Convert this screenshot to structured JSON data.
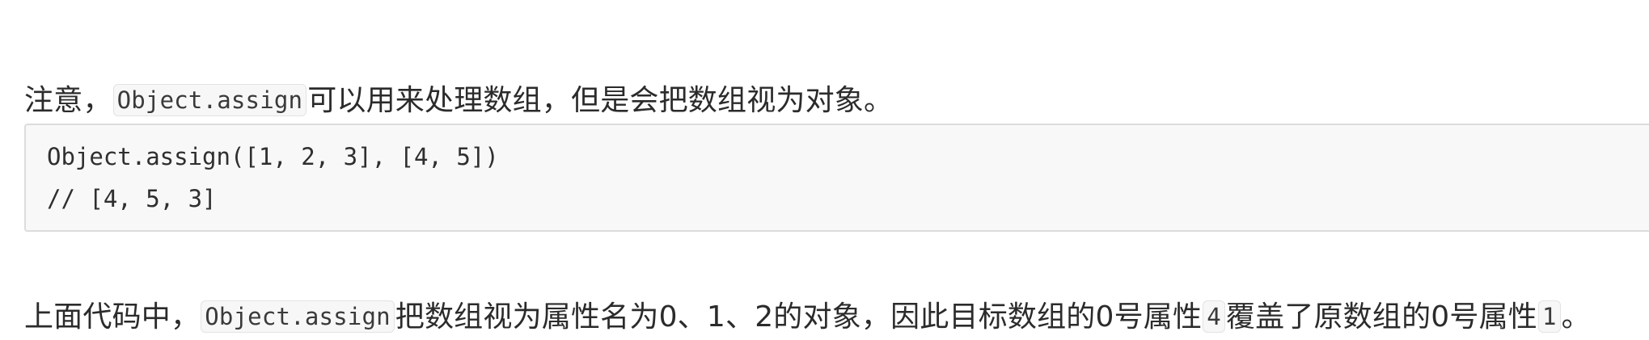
{
  "paragraph1": {
    "text_before": "注意，",
    "code": "Object.assign",
    "text_after": "可以用来处理数组，但是会把数组视为对象。"
  },
  "code_block": {
    "lines": [
      "Object.assign([1, 2, 3], [4, 5])",
      "// [4, 5, 3]"
    ]
  },
  "paragraph2": {
    "text_before": "上面代码中，",
    "code1": "Object.assign",
    "text_mid": "把数组视为属性名为0、1、2的对象，因此目标数组的0号属性",
    "code2": "4",
    "text_mid2": "覆盖了原数组的0号属性",
    "code3": "1",
    "text_after": "。"
  }
}
